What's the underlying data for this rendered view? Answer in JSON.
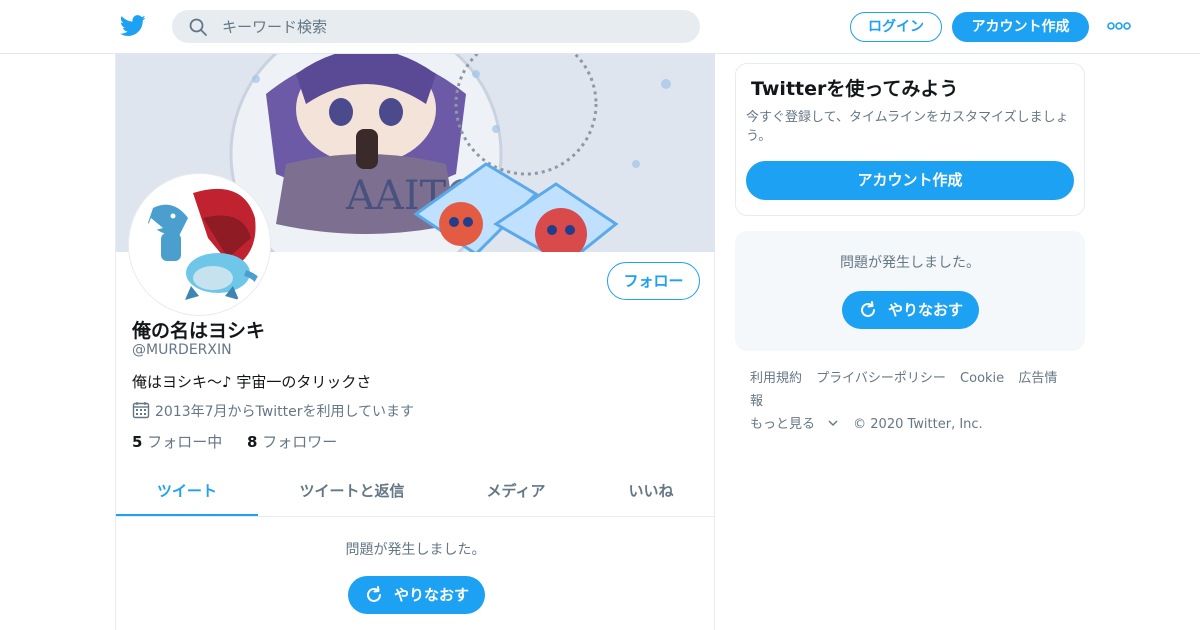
{
  "header": {
    "search_placeholder": "キーワード検索",
    "login_label": "ログイン",
    "signup_label": "アカウント作成"
  },
  "profile": {
    "follow_label": "フォロー",
    "name": "俺の名はヨシキ",
    "handle": "@MURDERXIN",
    "bio": "俺はヨシキ～♪ 宇宙一のタリックさ",
    "joined": "2013年7月からTwitterを利用しています",
    "following_count": "5",
    "following_label": "フォロー中",
    "followers_count": "8",
    "followers_label": "フォロワー"
  },
  "tabs": [
    {
      "label": "ツイート"
    },
    {
      "label": "ツイートと返信"
    },
    {
      "label": "メディア"
    },
    {
      "label": "いいね"
    }
  ],
  "timeline": {
    "error_text": "問題が発生しました。",
    "retry_label": "やりなおす"
  },
  "signup_card": {
    "title": "Twitterを使ってみよう",
    "description": "今すぐ登録して、タイムラインをカスタマイズしましょう。",
    "button_label": "アカウント作成"
  },
  "side_error": {
    "error_text": "問題が発生しました。",
    "retry_label": "やりなおす"
  },
  "footer": {
    "links": [
      "利用規約",
      "プライバシーポリシー",
      "Cookie",
      "広告情報"
    ],
    "more_label": "もっと見る",
    "copyright": "© 2020 Twitter, Inc."
  },
  "colors": {
    "accent": "#1da1f2",
    "muted_text": "#657786",
    "primary_text": "#14171a"
  }
}
